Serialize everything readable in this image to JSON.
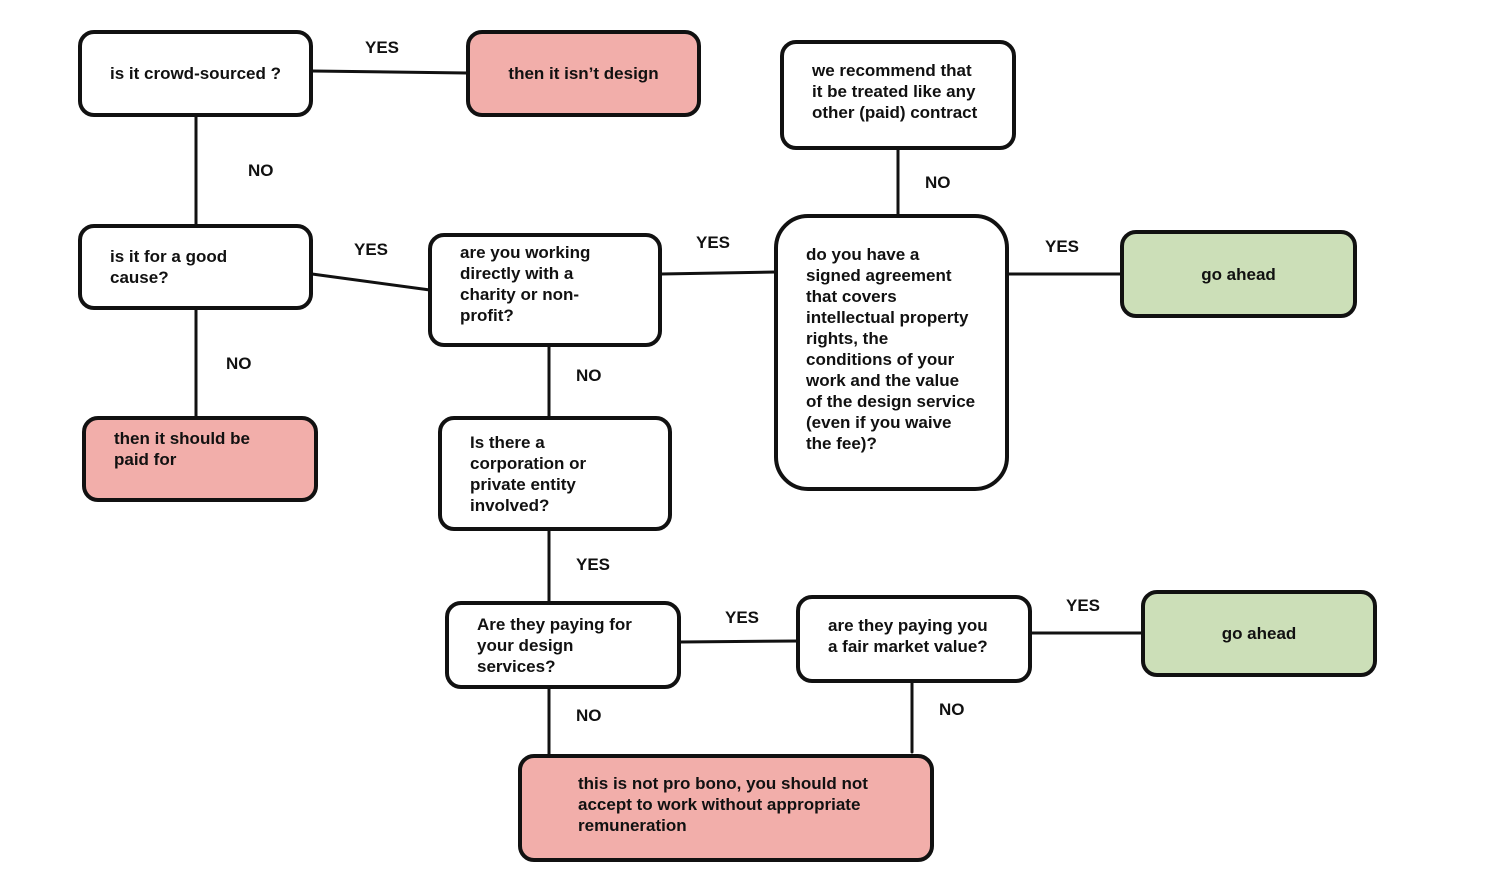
{
  "colors": {
    "negative_fill": "#F2AEAA",
    "positive_fill": "#CCDFB8",
    "question_fill": "#FFFFFF",
    "stroke": "#111111"
  },
  "nodes": {
    "crowd_sourced": "is it crowd-sourced ?",
    "not_design": "then it isn’t design",
    "good_cause": "is it for a good cause?",
    "should_be_paid": "then it should be paid for",
    "charity": "are you working directly with a charity or non-profit?",
    "corporation": "Is there a corporation or private entity involved?",
    "paying_services": "Are they paying for your design services?",
    "fair_market": "are they paying you a fair market value?",
    "go_ahead_bottom": "go ahead",
    "not_pro_bono": "this is not pro bono, you should not accept to work without appropriate remuneration",
    "signed_agreement": "do you have a signed agreement that covers intellectual property rights, the conditions of your work and the value of the design service (even if you waive the fee)?",
    "recommend_contract": "we recommend that it be treated like any other (paid) contract",
    "go_ahead_top": "go ahead"
  },
  "edges": {
    "crowd_yes": "YES",
    "crowd_no": "NO",
    "cause_yes": "YES",
    "cause_no": "NO",
    "charity_yes": "YES",
    "charity_no": "NO",
    "corp_yes": "YES",
    "paying_yes": "YES",
    "paying_no": "NO",
    "fair_yes": "YES",
    "fair_no": "NO",
    "agreement_yes": "YES",
    "agreement_no": "NO"
  }
}
